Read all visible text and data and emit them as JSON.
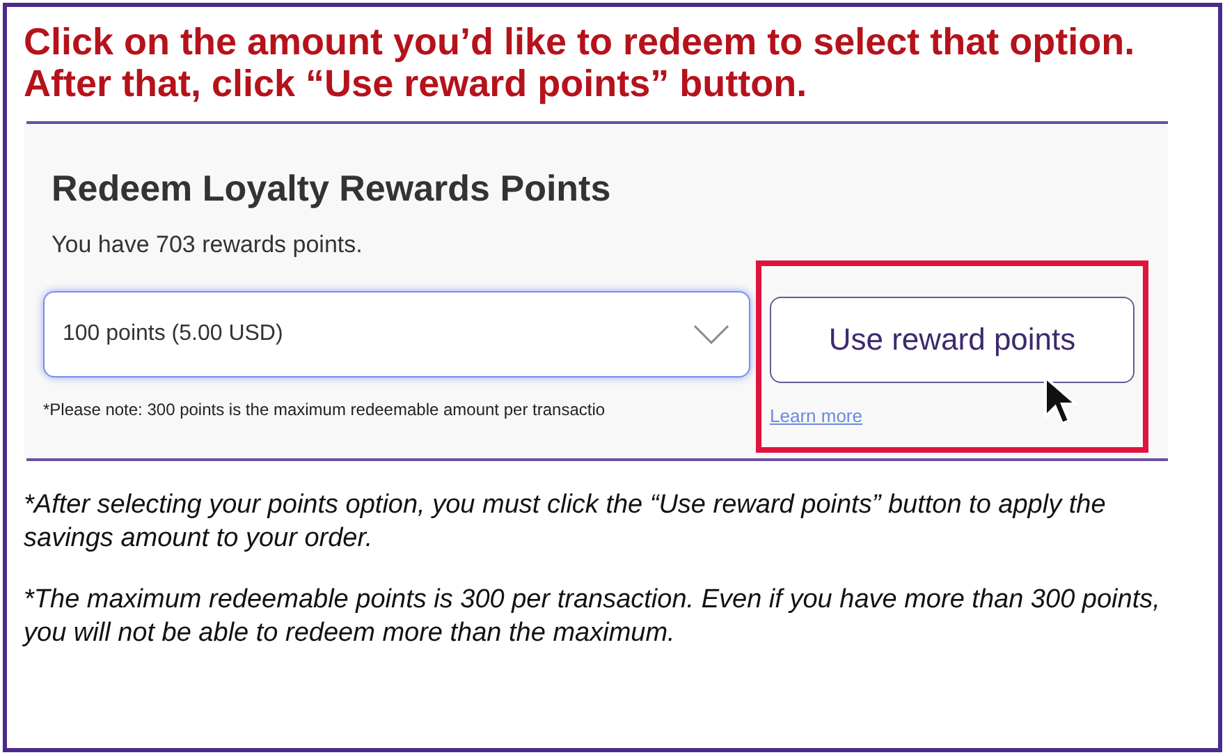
{
  "instruction": "Click on the amount you’d like to redeem to select that option. After that, click “Use reward points” button.",
  "panel": {
    "title": "Redeem Loyalty Rewards Points",
    "balance": "You have 703 rewards points.",
    "select": {
      "value": "100 points (5.00 USD)"
    },
    "button": "Use reward points",
    "note": "*Please note: 300 points is the maximum redeemable amount per transactio",
    "link": "Learn more"
  },
  "notes": [
    "*After selecting your points option, you must click the “Use reward points” button to apply the savings amount to your order.",
    "*The maximum redeemable points is 300 per transaction. Even if you have more than 300 points, you will not be able to redeem more than the maximum."
  ]
}
